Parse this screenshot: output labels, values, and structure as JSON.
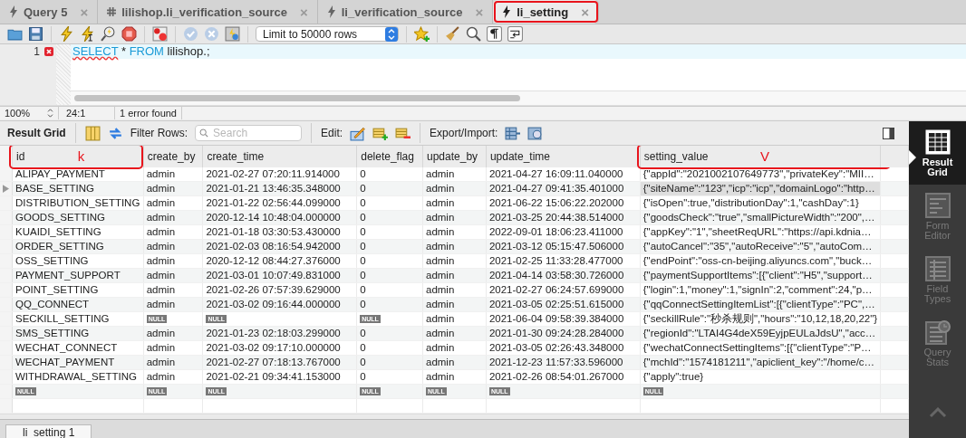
{
  "tabs": [
    {
      "label": "Query 5",
      "kind": "query",
      "selected": false,
      "highlighted": false
    },
    {
      "label": "lilishop.li_verification_source",
      "kind": "table",
      "selected": false,
      "highlighted": false
    },
    {
      "label": "li_verification_source",
      "kind": "query",
      "selected": false,
      "highlighted": false
    },
    {
      "label": "li_setting",
      "kind": "query",
      "selected": true,
      "highlighted": true
    }
  ],
  "close_glyph": "×",
  "toolbar": {
    "limit": "Limit to 50000 rows"
  },
  "editor": {
    "lines": [
      {
        "number": "1",
        "error": true,
        "tokens": [
          {
            "text": "SELECT",
            "kind": "keyword",
            "squiggle": true
          },
          {
            "text": " * ",
            "kind": "plain",
            "squiggle": false
          },
          {
            "text": "FROM",
            "kind": "keyword",
            "squiggle": false
          },
          {
            "text": " lilishop.;",
            "kind": "plain",
            "squiggle": false
          }
        ]
      }
    ]
  },
  "status_bar": {
    "zoom": "100%",
    "position": "24:1",
    "message": "1 error found"
  },
  "result_toolbar": {
    "title": "Result Grid",
    "filter_label": "Filter Rows:",
    "search_placeholder": "Search",
    "edit_label": "Edit:",
    "export_label": "Export/Import:"
  },
  "table": {
    "columns": [
      {
        "name": "id",
        "annotation": "k"
      },
      {
        "name": "create_by"
      },
      {
        "name": "create_time"
      },
      {
        "name": "delete_flag"
      },
      {
        "name": "update_by"
      },
      {
        "name": "update_time"
      },
      {
        "name": "setting_value",
        "annotation": "V"
      }
    ],
    "rows": [
      {
        "selected": false,
        "cells": [
          "ALIPAY_PAYMENT",
          "admin",
          "2021-02-27 07:20:11.914000",
          "0",
          "admin",
          "2021-04-27 16:09:11.040000",
          "{\"appId\":\"2021002107649773\",\"privateKey\":\"MII…"
        ]
      },
      {
        "selected": true,
        "cells": [
          "BASE_SETTING",
          "admin",
          "2021-01-21 13:46:35.348000",
          "0",
          "admin",
          "2021-04-27 09:41:35.401000",
          "{\"siteName\":\"123\",\"icp\":\"icp\",\"domainLogo\":\"http…"
        ]
      },
      {
        "selected": false,
        "cells": [
          "DISTRIBUTION_SETTING",
          "admin",
          "2021-01-22 02:56:44.099000",
          "0",
          "admin",
          "2021-06-22 15:06:22.202000",
          "{\"isOpen\":true,\"distributionDay\":1,\"cashDay\":1}"
        ]
      },
      {
        "selected": false,
        "cells": [
          "GOODS_SETTING",
          "admin",
          "2020-12-14 10:48:04.000000",
          "0",
          "admin",
          "2021-03-25 20:44:38.514000",
          "{\"goodsCheck\":\"true\",\"smallPictureWidth\":\"200\",…"
        ]
      },
      {
        "selected": false,
        "cells": [
          "KUAIDI_SETTING",
          "admin",
          "2021-01-18 03:30:53.430000",
          "0",
          "admin",
          "2022-09-01 18:06:23.411000",
          "{\"appKey\":\"1\",\"sheetReqURL\":\"https://api.kdnia…"
        ]
      },
      {
        "selected": false,
        "cells": [
          "ORDER_SETTING",
          "admin",
          "2021-02-03 08:16:54.942000",
          "0",
          "admin",
          "2021-03-12 05:15:47.506000",
          "{\"autoCancel\":\"35\",\"autoReceive\":\"5\",\"autoCom…"
        ]
      },
      {
        "selected": false,
        "cells": [
          "OSS_SETTING",
          "admin",
          "2020-12-12 08:44:27.376000",
          "0",
          "admin",
          "2021-02-25 11:33:28.477000",
          "{\"endPoint\":\"oss-cn-beijing.aliyuncs.com\",\"buck…"
        ]
      },
      {
        "selected": false,
        "cells": [
          "PAYMENT_SUPPORT",
          "admin",
          "2021-03-01 10:07:49.831000",
          "0",
          "admin",
          "2021-04-14 03:58:30.726000",
          "{\"paymentSupportItems\":[{\"client\":\"H5\",\"support…"
        ]
      },
      {
        "selected": false,
        "cells": [
          "POINT_SETTING",
          "admin",
          "2021-02-26 07:57:39.629000",
          "0",
          "admin",
          "2021-02-27 06:24:57.699000",
          "{\"login\":1,\"money\":1,\"signIn\":2,\"comment\":24,\"p…"
        ]
      },
      {
        "selected": false,
        "cells": [
          "QQ_CONNECT",
          "admin",
          "2021-03-02 09:16:44.000000",
          "0",
          "admin",
          "2021-03-05 02:25:51.615000",
          "{\"qqConnectSettingItemList\":[{\"clientType\":\"PC\",…"
        ]
      },
      {
        "selected": false,
        "cells": [
          "SECKILL_SETTING",
          {
            "null": "NULL"
          },
          {
            "null": "NULL"
          },
          {
            "null": "NULL"
          },
          "admin",
          "2021-06-04 09:58:39.384000",
          "{\"seckillRule\":\"秒杀规则\",\"hours\":\"10,12,18,20,22\"}"
        ]
      },
      {
        "selected": false,
        "cells": [
          "SMS_SETTING",
          "admin",
          "2021-01-23 02:18:03.299000",
          "0",
          "admin",
          "2021-01-30 09:24:28.284000",
          "{\"regionId\":\"LTAI4G4deX59EyjpEULaJdsU\",\"acc…"
        ]
      },
      {
        "selected": false,
        "cells": [
          "WECHAT_CONNECT",
          "admin",
          "2021-03-02 09:17:10.000000",
          "0",
          "admin",
          "2021-03-05 02:26:43.348000",
          "{\"wechatConnectSettingItems\":[{\"clientType\":\"P…"
        ]
      },
      {
        "selected": false,
        "cells": [
          "WECHAT_PAYMENT",
          "admin",
          "2021-02-27 07:18:13.767000",
          "0",
          "admin",
          "2021-12-23 11:57:33.596000",
          "{\"mchId\":\"1574181211\",\"apiclient_key\":\"/home/c…"
        ]
      },
      {
        "selected": false,
        "cells": [
          "WITHDRAWAL_SETTING",
          "admin",
          "2021-02-21 09:34:41.153000",
          "0",
          "admin",
          "2021-02-26 08:54:01.267000",
          "{\"apply\":true}"
        ]
      },
      {
        "selected": false,
        "cells": [
          {
            "null": "NULL"
          },
          {
            "null": "NULL"
          },
          {
            "null": "NULL"
          },
          {
            "null": "NULL"
          },
          {
            "null": "NULL"
          },
          {
            "null": "NULL"
          },
          {
            "null": "NULL"
          }
        ]
      }
    ]
  },
  "side_panel": [
    {
      "label": "Result Grid",
      "kind": "grid",
      "selected": true
    },
    {
      "label": "Form Editor",
      "kind": "form",
      "selected": false
    },
    {
      "label": "Field Types",
      "kind": "types",
      "selected": false
    },
    {
      "label": "Query Stats",
      "kind": "stats",
      "selected": false
    }
  ],
  "result_tabs": [
    {
      "label": "li_setting 1"
    }
  ]
}
